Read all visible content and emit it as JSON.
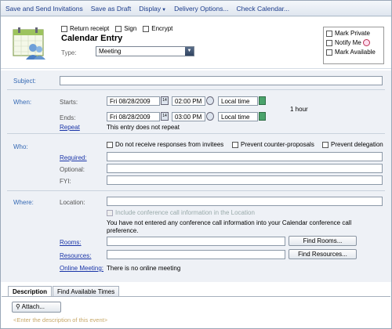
{
  "toolbar": {
    "save_send": "Save and Send Invitations",
    "save_draft": "Save as Draft",
    "display": "Display",
    "delivery": "Delivery Options...",
    "check_calendar": "Check Calendar..."
  },
  "header": {
    "return_receipt": "Return receipt",
    "sign": "Sign",
    "encrypt": "Encrypt",
    "title": "Calendar Entry",
    "type_label": "Type:",
    "type_value": "Meeting",
    "mark_private": "Mark Private",
    "notify_me": "Notify Me",
    "mark_available": "Mark Available"
  },
  "subject": {
    "label": "Subject:",
    "value": ""
  },
  "when": {
    "label": "When:",
    "starts_label": "Starts:",
    "start_date": "Fri 08/28/2009",
    "start_time": "02:00 PM",
    "start_tz": "Local time",
    "duration": "1 hour",
    "ends_label": "Ends:",
    "end_date": "Fri 08/28/2009",
    "end_time": "03:00 PM",
    "end_tz": "Local time",
    "repeat_link": "Repeat",
    "repeat_text": "This entry does not repeat",
    "cal_icon_text": "14"
  },
  "who": {
    "label": "Who:",
    "no_responses": "Do not receive responses from invitees",
    "prevent_counter": "Prevent counter-proposals",
    "prevent_delegation": "Prevent delegation",
    "required_link": "Required:",
    "optional_label": "Optional:",
    "fyi_label": "FYI:"
  },
  "where": {
    "label": "Where:",
    "location_label": "Location:",
    "conference_check": "Include conference call information in the Location",
    "conference_note_1": "You have not entered any conference call information into your Calendar conference call",
    "conference_note_2": "preference.",
    "rooms_link": "Rooms:",
    "find_rooms": "Find Rooms...",
    "resources_link": "Resources:",
    "find_resources": "Find Resources...",
    "online_meeting_link": "Online Meeting:",
    "online_meeting_text": "There is no online meeting"
  },
  "tabs": {
    "description": "Description",
    "find_times": "Find Available Times"
  },
  "description": {
    "attach": "Attach...",
    "placeholder": "<Enter the description of this event>"
  }
}
